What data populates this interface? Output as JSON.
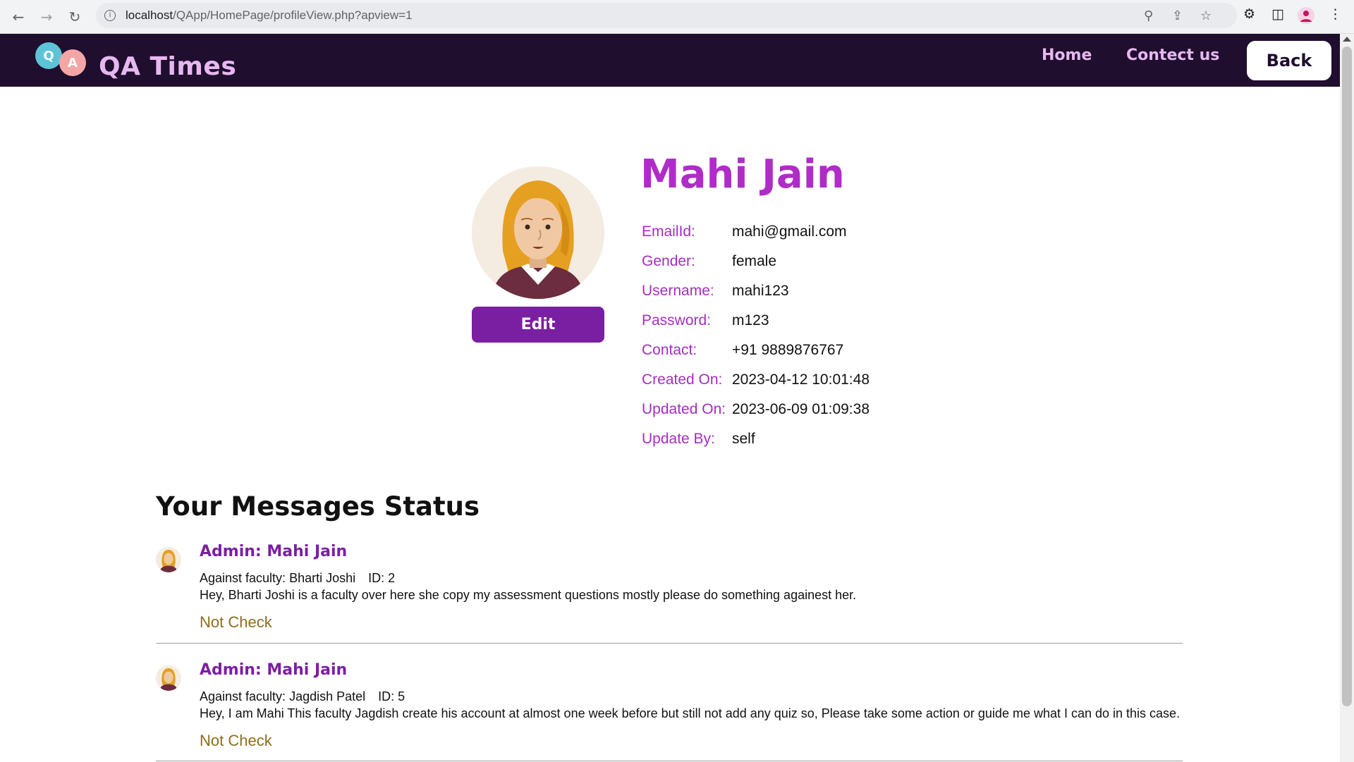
{
  "browser": {
    "url_host": "localhost",
    "url_path": "/QApp/HomePage/profileView.php?apview=1"
  },
  "navbar": {
    "logo_q": "Q",
    "logo_a": "A",
    "brand": "QA Times",
    "links": [
      "Home",
      "Contect us"
    ],
    "back_label": "Back"
  },
  "profile": {
    "name": "Mahi Jain",
    "edit_label": "Edit",
    "fields": [
      {
        "label": "EmailId:",
        "value": "mahi@gmail.com"
      },
      {
        "label": "Gender:",
        "value": "female"
      },
      {
        "label": "Username:",
        "value": "mahi123"
      },
      {
        "label": "Password:",
        "value": "m123"
      },
      {
        "label": "Contact:",
        "value": "+91 9889876767"
      },
      {
        "label": "Created On:",
        "value": "2023-04-12 10:01:48"
      },
      {
        "label": "Updated On:",
        "value": "2023-06-09 01:09:38"
      },
      {
        "label": "Update By:",
        "value": "self"
      }
    ]
  },
  "messages": {
    "title": "Your Messages Status",
    "items": [
      {
        "from": "Admin: Mahi Jain",
        "against": "Against faculty: Bharti Joshi",
        "id": "ID: 2",
        "body": "Hey, Bharti Joshi is a faculty over here she copy my assessment questions mostly please do something againest her.",
        "status": "Not Check"
      },
      {
        "from": "Admin: Mahi Jain",
        "against": "Against faculty: Jagdish Patel",
        "id": "ID: 5",
        "body": "Hey, I am Mahi This faculty Jagdish create his account at almost one week before but still not add any quiz so, Please take some action or guide me what I can do in this case.",
        "status": "Not Check"
      }
    ]
  },
  "colors": {
    "navbar_bg": "#1f0e2e",
    "accent_purple": "#7b1fa2",
    "name_magenta": "#b02cc8",
    "status_gold": "#8d6e1e"
  }
}
